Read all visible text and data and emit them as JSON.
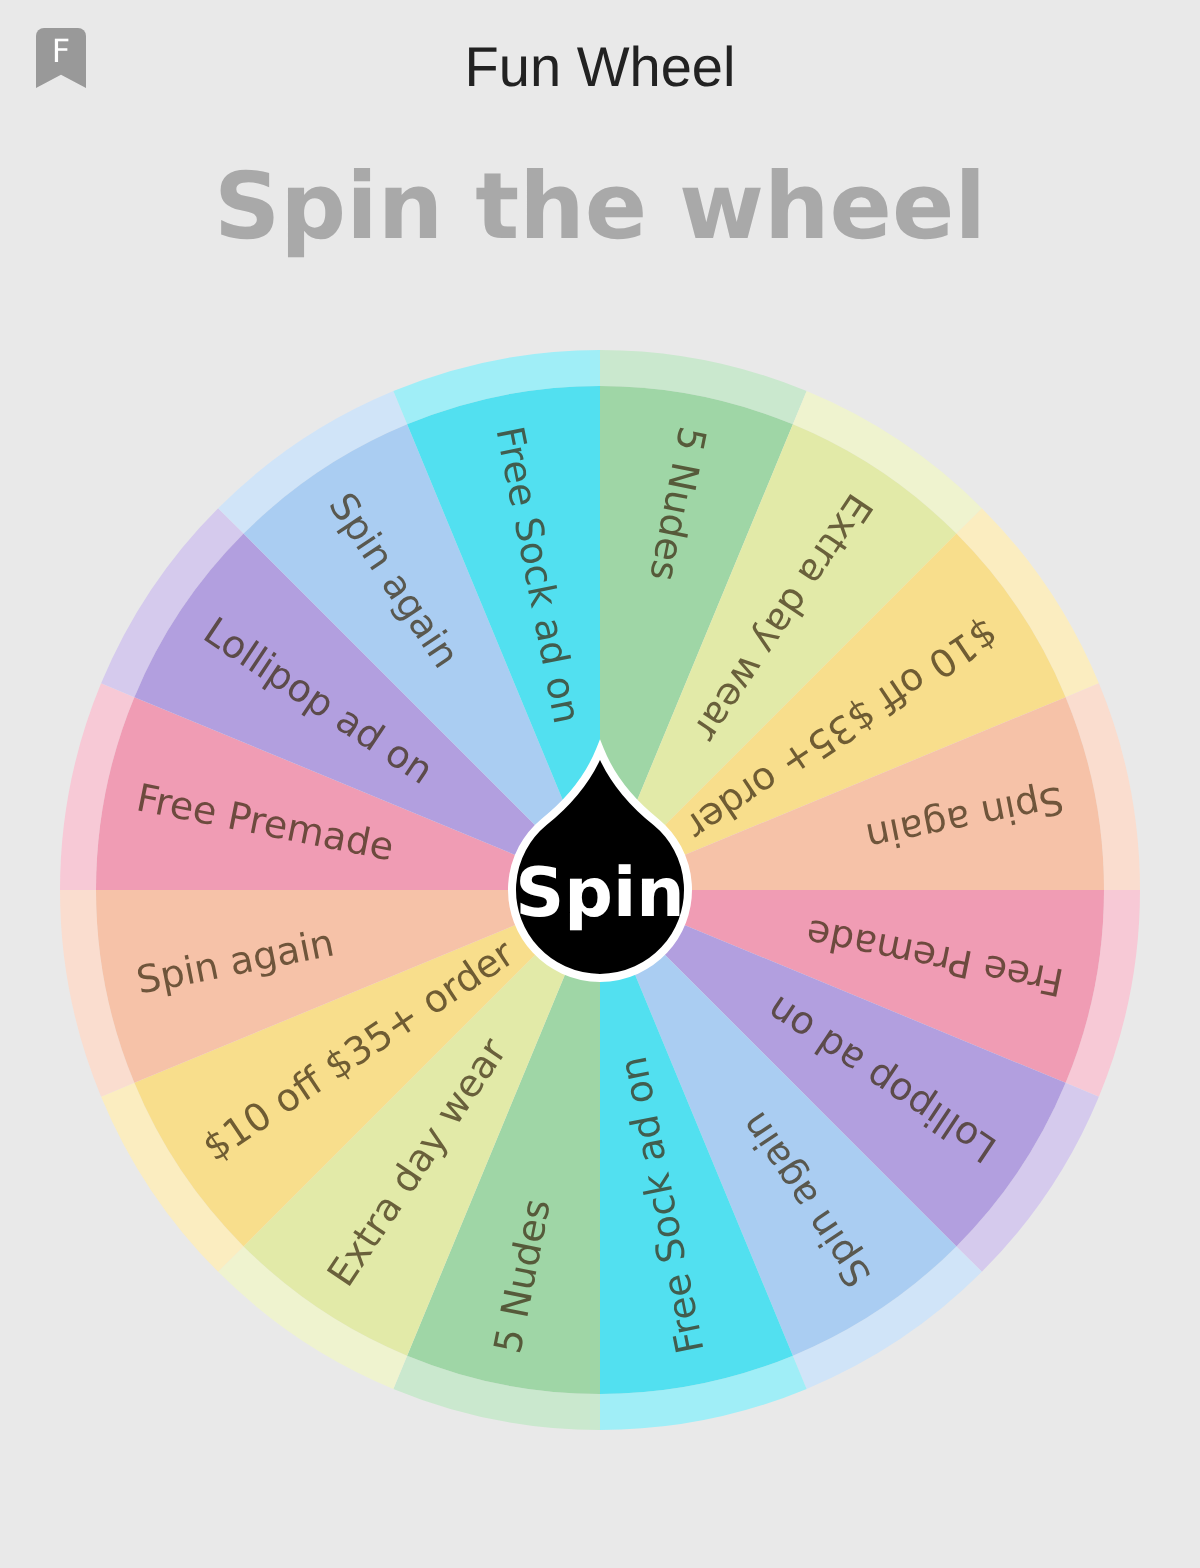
{
  "app_badge": "F",
  "title": "Fun Wheel",
  "heading": "Spin the wheel",
  "segments": [
    {
      "label": "5 Nudes",
      "color": "#9fd6a6"
    },
    {
      "label": "Extra day wear",
      "color": "#e2eaa8"
    },
    {
      "label": "$10 off $35+ order",
      "color": "#f8de8c"
    },
    {
      "label": "Spin again",
      "color": "#f6c2a8"
    },
    {
      "label": "Free Premade",
      "color": "#f09cb4"
    },
    {
      "label": "Lollipop ad on",
      "color": "#b29fdf"
    },
    {
      "label": "Spin again",
      "color": "#aacdf2"
    },
    {
      "label": "Free Sock ad on",
      "color": "#52e0f0"
    },
    {
      "label": "5 Nudes",
      "color": "#9fd6a6"
    },
    {
      "label": "Extra day wear",
      "color": "#e2eaa8"
    },
    {
      "label": "$10 off $35+ order",
      "color": "#f8de8c"
    },
    {
      "label": "Spin again",
      "color": "#f6c2a8"
    },
    {
      "label": "Free Premade",
      "color": "#f09cb4"
    },
    {
      "label": "Lollipop ad on",
      "color": "#b29fdf"
    },
    {
      "label": "Spin again",
      "color": "#aacdf2"
    },
    {
      "label": "Free Sock ad on",
      "color": "#52e0f0"
    }
  ],
  "spin_button": "Spin"
}
